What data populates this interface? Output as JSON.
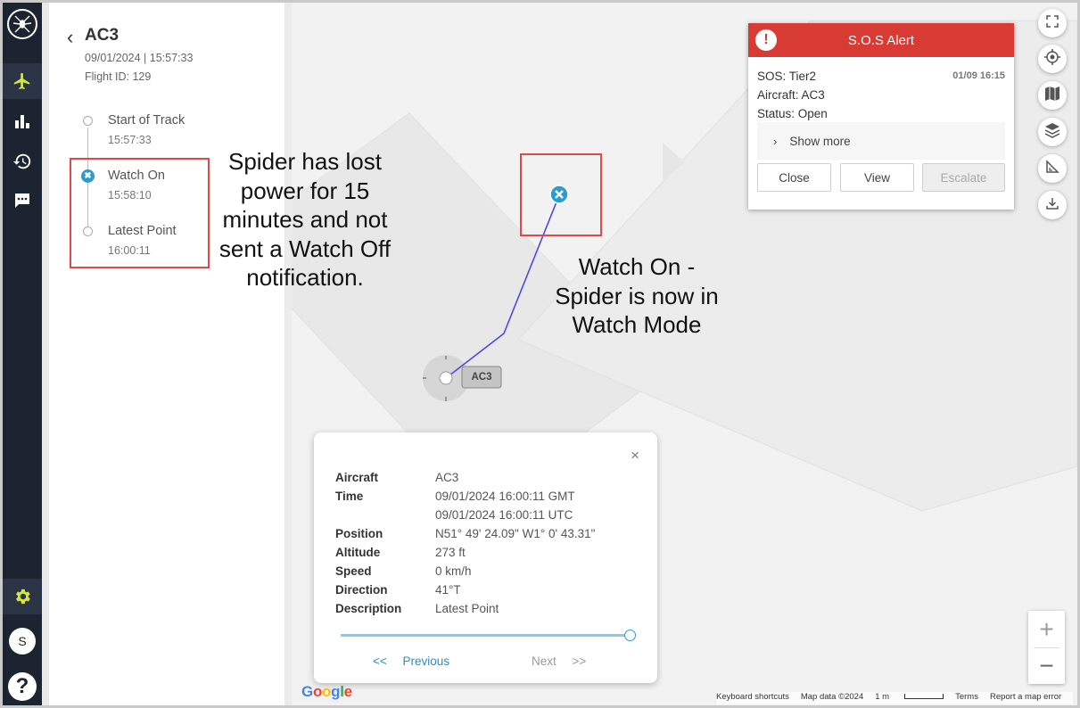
{
  "nav": {
    "icons": [
      "spider-logo",
      "plane-icon",
      "bar-chart-icon",
      "history-icon",
      "chat-icon",
      "gear-icon",
      "help-icon"
    ],
    "avatar_initial": "S",
    "help_label": "?",
    "active_color": "#d4e63a"
  },
  "panel": {
    "back_glyph": "‹",
    "title": "AC3",
    "datetime": "09/01/2024 | 15:57:33",
    "flight_id": "Flight ID: 129",
    "timeline": [
      {
        "label": "Start of Track",
        "time": "15:57:33",
        "state": "point"
      },
      {
        "label": "Watch On",
        "time": "15:58:10",
        "state": "watch-on"
      },
      {
        "label": "Latest Point",
        "time": "16:00:11",
        "state": "point"
      }
    ]
  },
  "annotations": {
    "left": [
      "Spider has lost",
      "power for 15",
      "minutes and not",
      "sent a Watch Off",
      "notification."
    ],
    "right": [
      "Watch On -",
      "Spider is now in",
      "Watch Mode"
    ],
    "box_color": "#e0484a"
  },
  "map": {
    "aircraft_label": "AC3",
    "track_color": "#4a4ae0",
    "watch_on_color": "#2c9ccf",
    "google_logo": "Google",
    "attribution": {
      "shortcuts": "Keyboard shortcuts",
      "map_data": "Map data ©2024",
      "scale": "1 m",
      "terms": "Terms",
      "report": "Report a map error"
    },
    "zoom_in": "+",
    "zoom_out": "−",
    "controls": [
      "fullscreen-icon",
      "locate-icon",
      "map-type-icon",
      "layers-icon",
      "measure-icon",
      "download-icon"
    ]
  },
  "sos": {
    "title": "S.O.S Alert",
    "bang": "!",
    "sos_line": "SOS: Tier2",
    "aircraft_line": "Aircraft: AC3",
    "status_line": "Status: Open",
    "date": "01/09 16:15",
    "show_more": "Show more",
    "show_more_chevron": "›",
    "buttons": {
      "close": "Close",
      "view": "View",
      "escalate": "Escalate"
    },
    "header_color": "#d83a34"
  },
  "popup": {
    "close_glyph": "×",
    "rows": [
      {
        "key": "Aircraft",
        "value": "AC3"
      },
      {
        "key": "Time",
        "value": "09/01/2024 16:00:11 GMT"
      },
      {
        "key": "",
        "value": "09/01/2024 16:00:11 UTC"
      },
      {
        "key": "Position",
        "value": "N51° 49' 24.09\" W1° 0' 43.31\""
      },
      {
        "key": "Altitude",
        "value": "273 ft"
      },
      {
        "key": "Speed",
        "value": "0 km/h"
      },
      {
        "key": "Direction",
        "value": "41°T"
      },
      {
        "key": "Description",
        "value": "Latest Point"
      }
    ],
    "slider_position": 1.0,
    "prev_arrows": "<<",
    "prev_label": "Previous",
    "next_label": "Next",
    "next_arrows": ">>"
  }
}
